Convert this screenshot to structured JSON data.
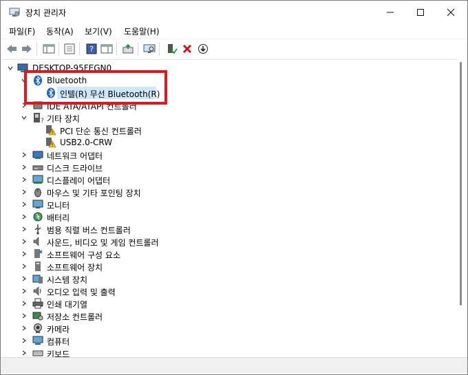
{
  "window": {
    "title": "장치 관리자",
    "minimize": "—",
    "maximize": "☐",
    "close": "✕"
  },
  "menu": [
    "파일(F)",
    "동작(A)",
    "보기(V)",
    "도움말(H)"
  ],
  "toolbar": {
    "icons": [
      "back-icon",
      "forward-icon",
      "show-hide-tree-icon",
      "properties-icon",
      "help-icon",
      "action-pane-icon",
      "update-driver-icon",
      "scan-hardware-icon",
      "enable-device-icon",
      "uninstall-device-icon",
      "download-icon"
    ]
  },
  "tree": {
    "root": "DESKTOP-95FEGN0",
    "bluetooth": "Bluetooth",
    "bluetooth_child": "인텔(R) 무선 Bluetooth(R)",
    "ide": "IDE ATA/ATAPI 컨트롤러",
    "other": "기타 장치",
    "other_child1": "PCI 단순 통신 컨트롤러",
    "other_child2": "USB2.0-CRW",
    "categories": [
      "네트워크 어댑터",
      "디스크 드라이브",
      "디스플레이 어댑터",
      "마우스 및 기타 포인팅 장치",
      "모니터",
      "배터리",
      "범용 직렬 버스 컨트롤러",
      "사운드, 비디오 및 게임 컨트롤러",
      "소프트웨어 구성 요소",
      "소프트웨어 장치",
      "시스템 장치",
      "오디오 입력 및 출력",
      "인쇄 대기열",
      "저장소 컨트롤러",
      "카메라",
      "컴퓨터",
      "키보드"
    ]
  },
  "colors": {
    "selection": "#cce8ff",
    "highlight_box": "#e8141a",
    "bluetooth_blue": "#1565c0"
  }
}
